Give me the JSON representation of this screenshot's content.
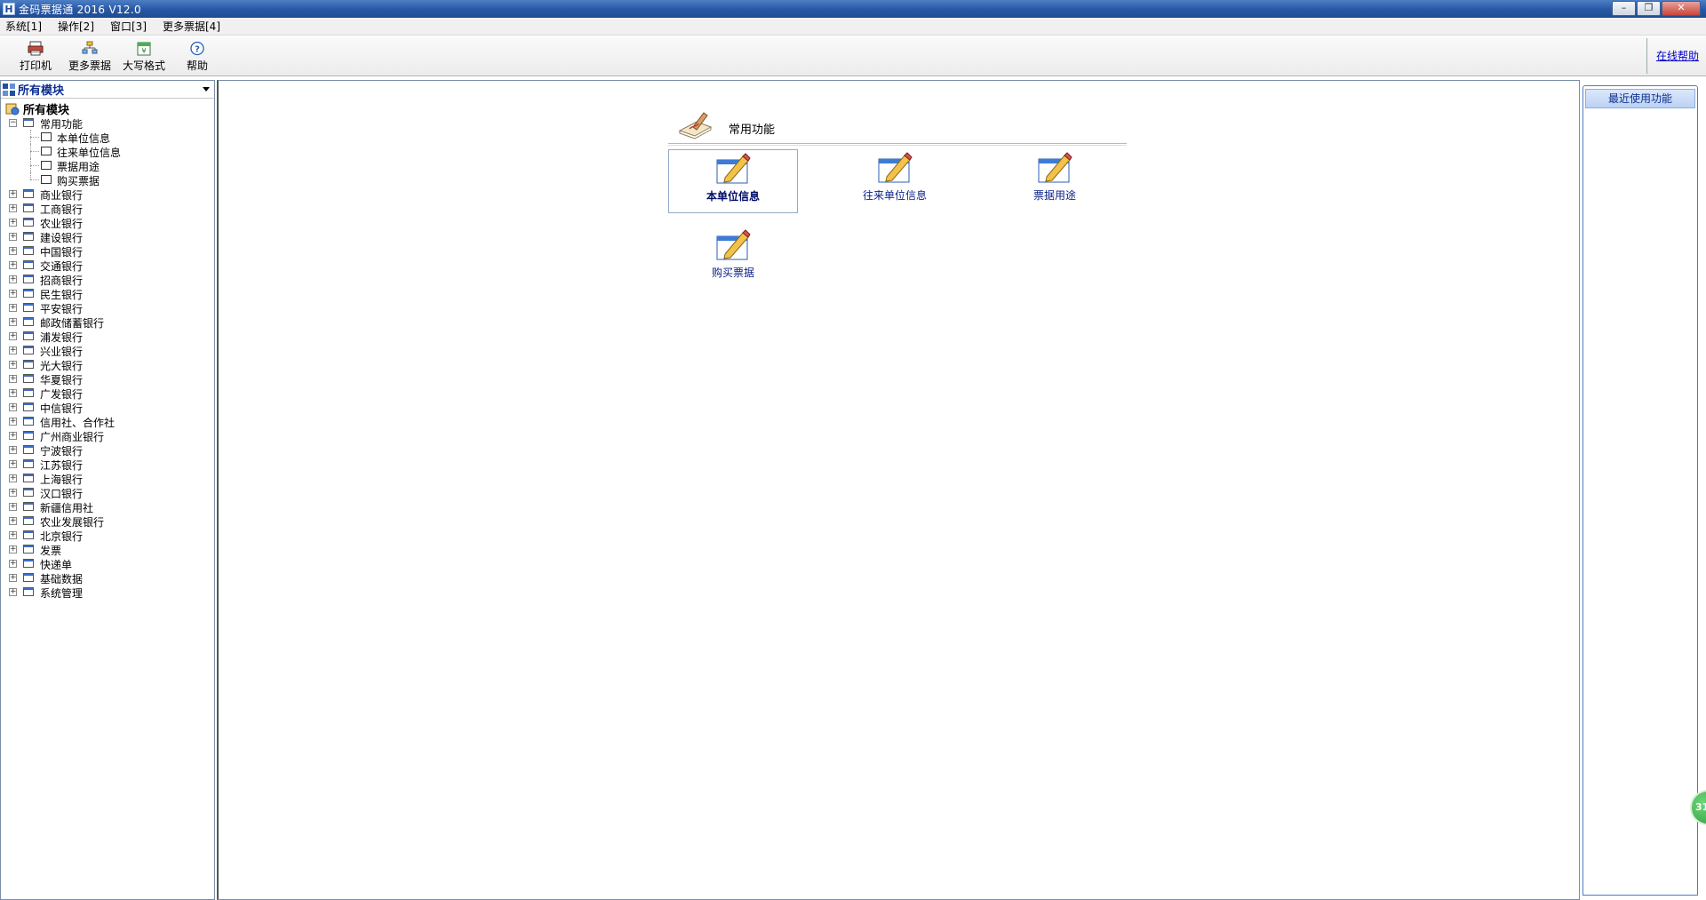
{
  "window": {
    "app_icon_text": "H",
    "title": "金码票据通 2016   V12.0",
    "minimize": "–",
    "maximize": "❐",
    "close": "✕"
  },
  "menu": [
    "系统[1]",
    "操作[2]",
    "窗口[3]",
    "更多票据[4]"
  ],
  "toolbar": {
    "buttons": [
      "打印机",
      "更多票据",
      "大写格式",
      "帮助"
    ],
    "online_help": "在线帮助"
  },
  "sidebar": {
    "header": "所有模块",
    "root": "所有模块",
    "group_common": "常用功能",
    "common_children": [
      "本单位信息",
      "往来单位信息",
      "票据用途",
      "购买票据"
    ],
    "groups": [
      "商业银行",
      "工商银行",
      "农业银行",
      "建设银行",
      "中国银行",
      "交通银行",
      "招商银行",
      "民生银行",
      "平安银行",
      "邮政储蓄银行",
      "浦发银行",
      "兴业银行",
      "光大银行",
      "华夏银行",
      "广发银行",
      "中信银行",
      "信用社、合作社",
      "广州商业银行",
      "宁波银行",
      "江苏银行",
      "上海银行",
      "汉口银行",
      "新疆信用社",
      "农业发展银行",
      "北京银行",
      "发票",
      "快递单",
      "基础数据",
      "系统管理"
    ]
  },
  "main": {
    "section_title": "常用功能",
    "tiles": [
      "本单位信息",
      "往来单位信息",
      "票据用途",
      "购买票据"
    ]
  },
  "recent": {
    "header": "最近使用功能"
  },
  "float_widget": "31"
}
